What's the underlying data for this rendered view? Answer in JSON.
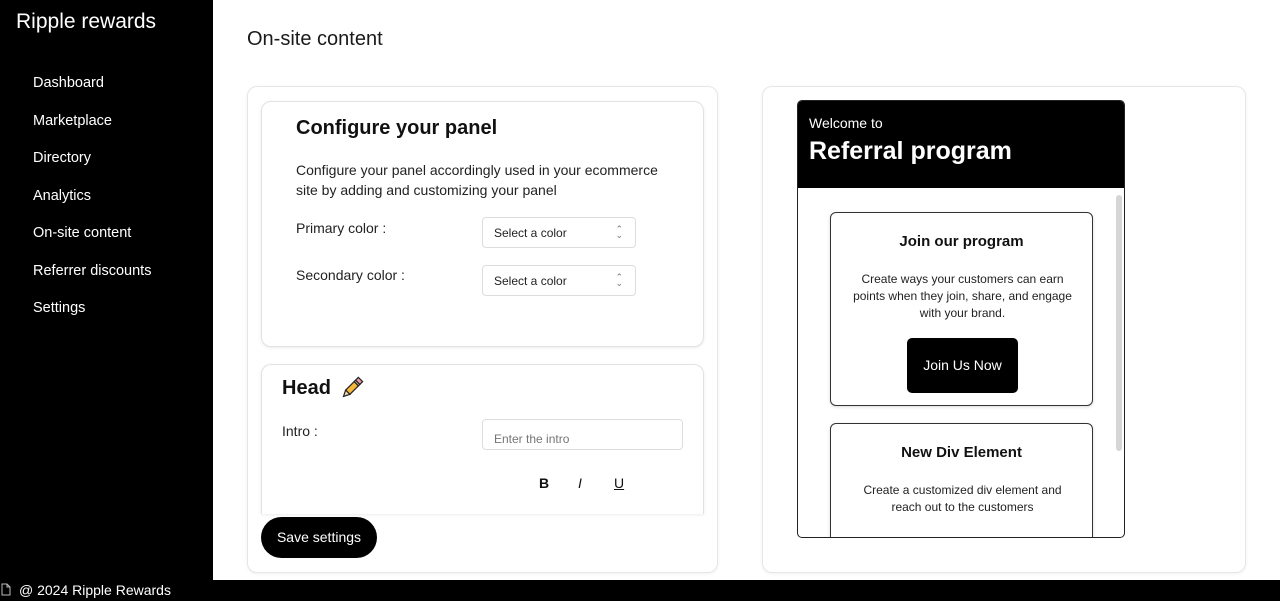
{
  "app": {
    "brand": "Ripple rewards"
  },
  "sidebar": {
    "items": [
      {
        "label": "Dashboard"
      },
      {
        "label": "Marketplace"
      },
      {
        "label": "Directory"
      },
      {
        "label": "Analytics"
      },
      {
        "label": "On-site content"
      },
      {
        "label": "Referrer discounts"
      },
      {
        "label": "Settings"
      }
    ]
  },
  "page": {
    "title": "On-site content"
  },
  "configure": {
    "title": "Configure your panel",
    "description": "Configure your panel accordingly used in your ecommerce site by adding and customizing your panel",
    "primary_label": "Primary color :",
    "primary_value": "Select a color",
    "secondary_label": "Secondary color :",
    "secondary_value": "Select a color"
  },
  "head": {
    "title": "Head",
    "intro_label": "Intro :",
    "intro_placeholder": "Enter the intro",
    "bold": "B",
    "italic": "I",
    "underline": "U"
  },
  "actions": {
    "save_label": "Save settings"
  },
  "preview": {
    "welcome": "Welcome to",
    "title": "Referral program",
    "card1": {
      "title": "Join our program",
      "text": "Create ways your customers can earn points when they join, share, and engage with your brand.",
      "button": "Join Us Now"
    },
    "card2": {
      "title": "New Div Element",
      "text": "Create a customized div element and reach out to the customers"
    }
  },
  "footer": {
    "text": "@ 2024 Ripple Rewards"
  },
  "colors": {
    "sidebar_bg": "#000000",
    "accent": "#000000",
    "pencil": "#f5b83d"
  },
  "icons": [
    "document-icon",
    "pencil-icon",
    "chevron-updown-icon"
  ]
}
